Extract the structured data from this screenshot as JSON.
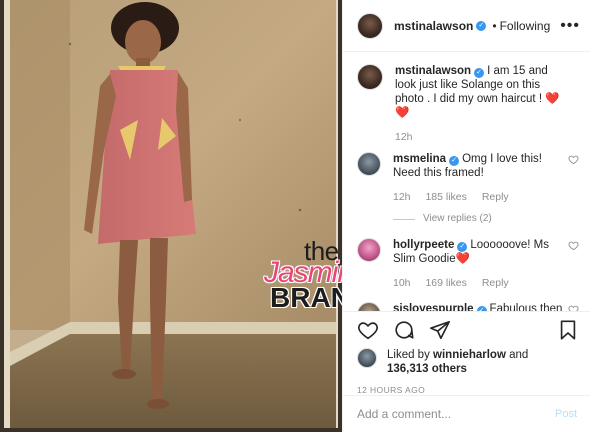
{
  "post": {
    "author": "mstinalawson",
    "follow_status": "Following",
    "separator": "•",
    "more_glyph": "•••"
  },
  "caption": {
    "username": "mstinalawson",
    "text": "I am 15 and look just like Solange on this photo . I did my own haircut ! ❤️❤️",
    "time": "12h"
  },
  "comments": [
    {
      "username": "msmelina",
      "text": "Omg I love this! Need this framed!",
      "time": "12h",
      "likes": "185 likes",
      "reply": "Reply",
      "view_replies": "View replies (2)"
    },
    {
      "username": "hollyrpeete",
      "text": "Loooooove! Ms Slim Goodie❤️",
      "time": "10h",
      "likes": "169 likes",
      "reply": "Reply"
    },
    {
      "username": "sislovespurple",
      "text": "Fabulous then and STILL 😍 @mstinalawson"
    }
  ],
  "likes": {
    "prefix": "Liked by",
    "user": "winnieharlow",
    "middle": "and",
    "count": "136,313",
    "suffix": "others"
  },
  "timestamp": "12 HOURS AGO",
  "add_comment": {
    "placeholder": "Add a comment...",
    "post_label": "Post"
  },
  "watermark": {
    "line1": "the",
    "line2": "Jasmine",
    "line3": "BRAND"
  },
  "colors": {
    "verified": "#3897f0",
    "post_disabled": "#b2dffc",
    "meta_gray": "#8e8e8e",
    "watermark_pink": "#e8467a"
  }
}
